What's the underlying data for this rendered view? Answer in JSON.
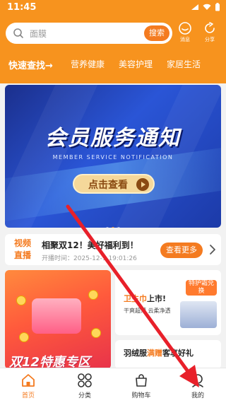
{
  "status_bar": {
    "time": "11:45"
  },
  "search": {
    "placeholder": "面膜",
    "button_label": "搜索"
  },
  "top_actions": [
    {
      "label": "消息",
      "icon": "message-icon"
    },
    {
      "label": "分享",
      "icon": "share-icon"
    }
  ],
  "tabs": [
    {
      "label": "快速查找→",
      "active": true
    },
    {
      "label": "营养健康"
    },
    {
      "label": "美容护理"
    },
    {
      "label": "家居生活"
    }
  ],
  "banner": {
    "title": "会员服务通知",
    "subtitle": "MEMBER SERVICE NOTIFICATION",
    "cta_label": "点击查看",
    "dot_count": 3,
    "active_dot": 1
  },
  "live": {
    "badge_line1": "视频",
    "badge_line2": "直播",
    "title": "相聚双12！美好福利到！",
    "time": "开播时间：2025-12-1  19:01:26",
    "more_label": "查看更多"
  },
  "promo": {
    "left_text": "双12特惠专区",
    "right_top_title_a": "卫生巾",
    "right_top_title_b": "上市!",
    "right_top_sub": "干爽超薄 云柔净透",
    "right_top_tag": "特护霜兑换",
    "right_bottom_title_a": "羽绒服",
    "right_bottom_title_b": "满赠",
    "right_bottom_title_c": "客享好礼"
  },
  "bottom_nav": [
    {
      "label": "首页",
      "icon": "home-icon",
      "active": true
    },
    {
      "label": "分类",
      "icon": "grid-icon"
    },
    {
      "label": "购物车",
      "icon": "cart-icon"
    },
    {
      "label": "我的",
      "icon": "user-icon"
    }
  ],
  "colors": {
    "brand_orange": "#f7931e",
    "accent": "#f47b20",
    "arrow_red": "#e8202a"
  }
}
